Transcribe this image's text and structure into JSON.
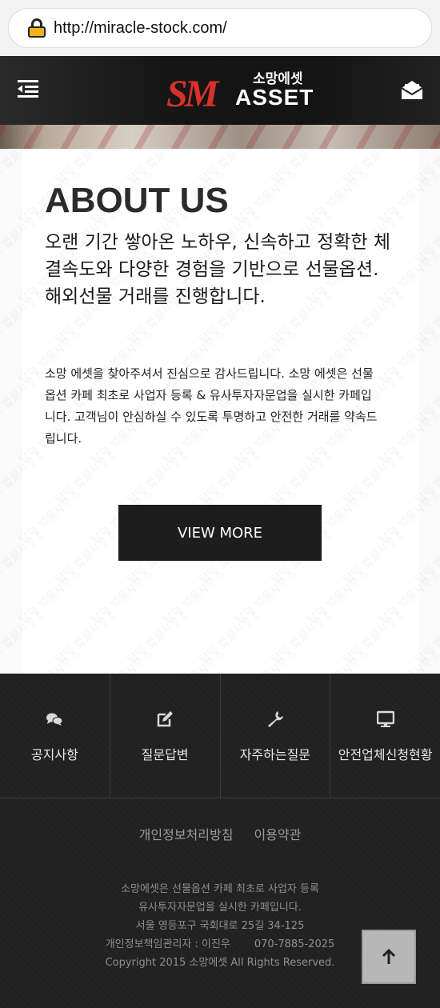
{
  "browser": {
    "url": "http://miracle-stock.com/"
  },
  "header": {
    "logo_sm": "SM",
    "logo_kor": "소망에셋",
    "logo_asset": "ASSET",
    "icons": [
      "menu-icon",
      "mail-icon"
    ]
  },
  "about": {
    "title": "ABOUT US",
    "lead": "오랜 기간 쌓아온 노하우, 신속하고 정확한 체결속도와 다양한 경험을 기반으로 선물옵션.해외선물 거래를 진행합니다.",
    "body": "소망 에셋을 찾아주셔서 진심으로 감사드립니다. 소망 에셋은 선물옵션 카페 최초로 사업자 등록 & 유사투자자문업을 실시한 카페입니다. 고객님이 안심하실 수 있도록 투명하고 안전한 거래를 약속드립니다.",
    "button": "VIEW MORE",
    "watermark": "담덕 법률사무소"
  },
  "footer": {
    "quick": [
      {
        "label": "공지사항",
        "icon": "chat-icon"
      },
      {
        "label": "질문답변",
        "icon": "edit-icon"
      },
      {
        "label": "자주하는질문",
        "icon": "wrench-icon"
      },
      {
        "label": "안전업체신청현황",
        "icon": "monitor-icon"
      }
    ],
    "links": [
      "개인정보처리방침",
      "이용약관"
    ],
    "info": {
      "line1": "소망에셋은 선물옵션 카페 최초로 사업자 등록",
      "line2": "유사투자자문업을 실시한 카페입니다.",
      "line3": "서울 영등포구 국회대로 25길 34-125",
      "line4": "개인정보책임관리자 : 이진우",
      "phone": "070-7885-2025",
      "copyright": "Copyright 2015 소망에셋 All Rights Reserved."
    },
    "top_button_icon": "arrow-up-icon"
  },
  "colors": {
    "brand_red": "#d7312b",
    "dark": "#1d1d1d",
    "footer_bg": "#212121"
  }
}
